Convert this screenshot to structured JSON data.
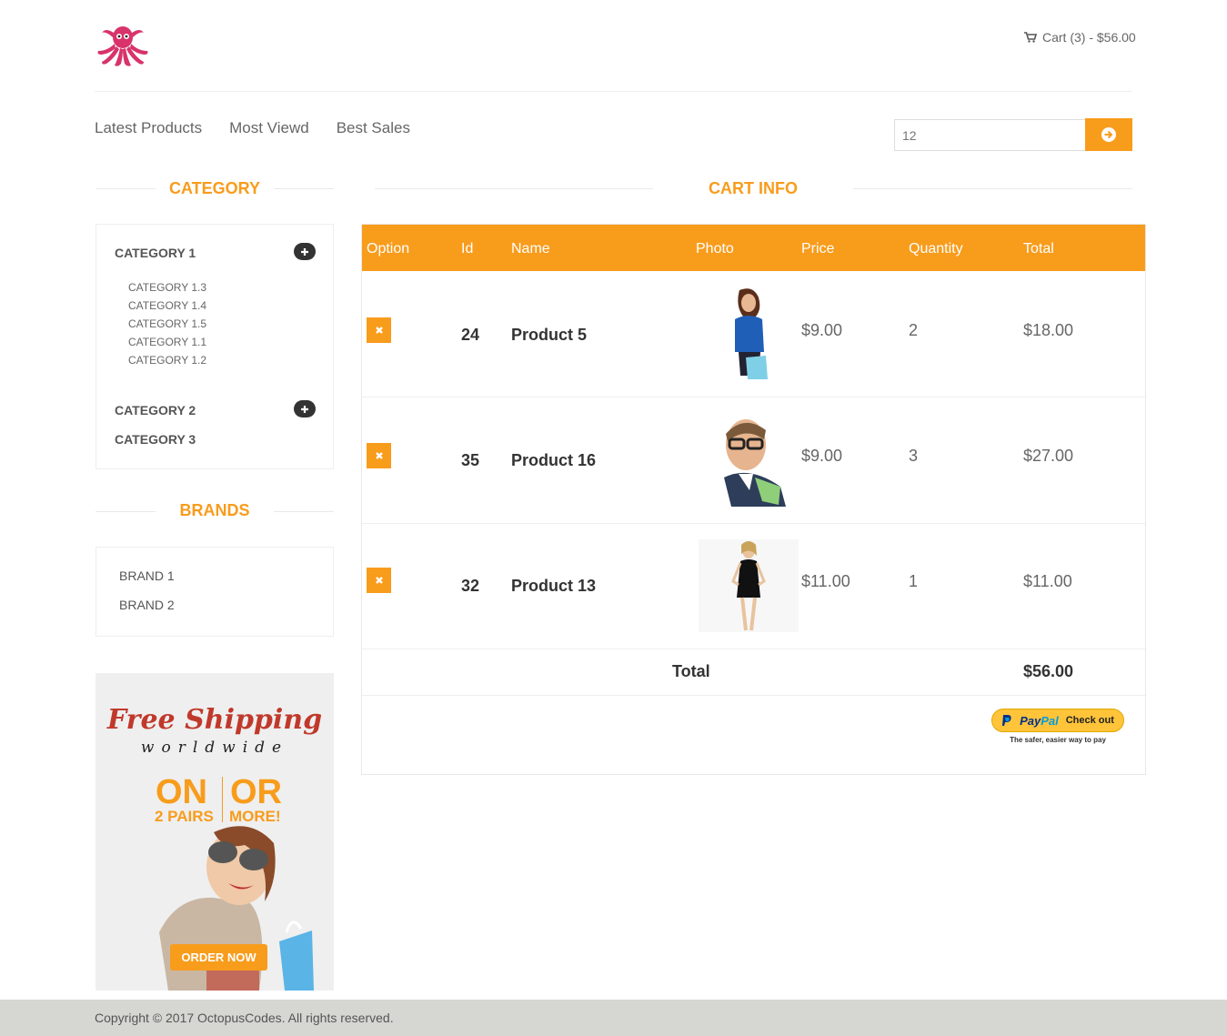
{
  "header": {
    "cart_label": "Cart (3) - $56.00"
  },
  "nav": {
    "items": [
      "Latest Products",
      "Most Viewd",
      "Best Sales"
    ]
  },
  "search": {
    "value": "",
    "placeholder": "12"
  },
  "category": {
    "title": "CATEGORY",
    "groups": [
      {
        "label": "CATEGORY 1",
        "children": [
          "CATEGORY 1.3",
          "CATEGORY 1.4",
          "CATEGORY 1.5",
          "CATEGORY 1.1",
          "CATEGORY 1.2"
        ]
      },
      {
        "label": "CATEGORY 2",
        "children": []
      },
      {
        "label": "CATEGORY 3",
        "children": []
      }
    ]
  },
  "brands": {
    "title": "BRANDS",
    "items": [
      "BRAND 1",
      "BRAND 2"
    ]
  },
  "ad": {
    "line1": "Free Shipping",
    "line2": "worldwide",
    "on": "ON",
    "or": "OR",
    "pairs": "2 PAIRS",
    "more": "MORE!",
    "button": "ORDER NOW"
  },
  "cart": {
    "title": "CART INFO",
    "columns": [
      "Option",
      "Id",
      "Name",
      "Photo",
      "Price",
      "Quantity",
      "Total"
    ],
    "rows": [
      {
        "id": "24",
        "name": "Product 5",
        "price": "$9.00",
        "quantity": "2",
        "total": "$18.00"
      },
      {
        "id": "35",
        "name": "Product 16",
        "price": "$9.00",
        "quantity": "3",
        "total": "$27.00"
      },
      {
        "id": "32",
        "name": "Product 13",
        "price": "$11.00",
        "quantity": "1",
        "total": "$11.00"
      }
    ],
    "total_label": "Total",
    "total_value": "$56.00"
  },
  "paypal": {
    "brand_a": "Pay",
    "brand_b": "Pal",
    "checkout": "Check out",
    "tagline": "The safer, easier way to pay"
  },
  "footer": {
    "copyright": "Copyright © 2017 OctopusCodes. All rights reserved."
  },
  "colors": {
    "accent": "#f89c1c",
    "footer_bg": "#d6d6d2"
  }
}
